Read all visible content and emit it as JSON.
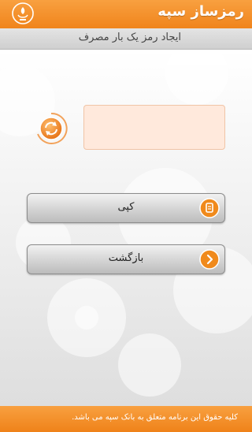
{
  "header": {
    "app_title": "رمزساز سپه",
    "logo_icon": "bank-sepah-emblem-icon"
  },
  "titlebar": {
    "title": "ایجاد رمز یک بار مصرف"
  },
  "otp": {
    "value": "",
    "refresh_icon": "refresh-icon"
  },
  "buttons": {
    "copy_label": "کپی",
    "copy_icon": "copy-icon",
    "back_label": "بازگشت",
    "back_icon": "chevron-right-icon"
  },
  "footer": {
    "text": "کلیه حقوق این برنامه متعلق به بانک سپه می باشد."
  },
  "colors": {
    "accent": "#f0841c",
    "field_bg": "#ffe9dc"
  }
}
